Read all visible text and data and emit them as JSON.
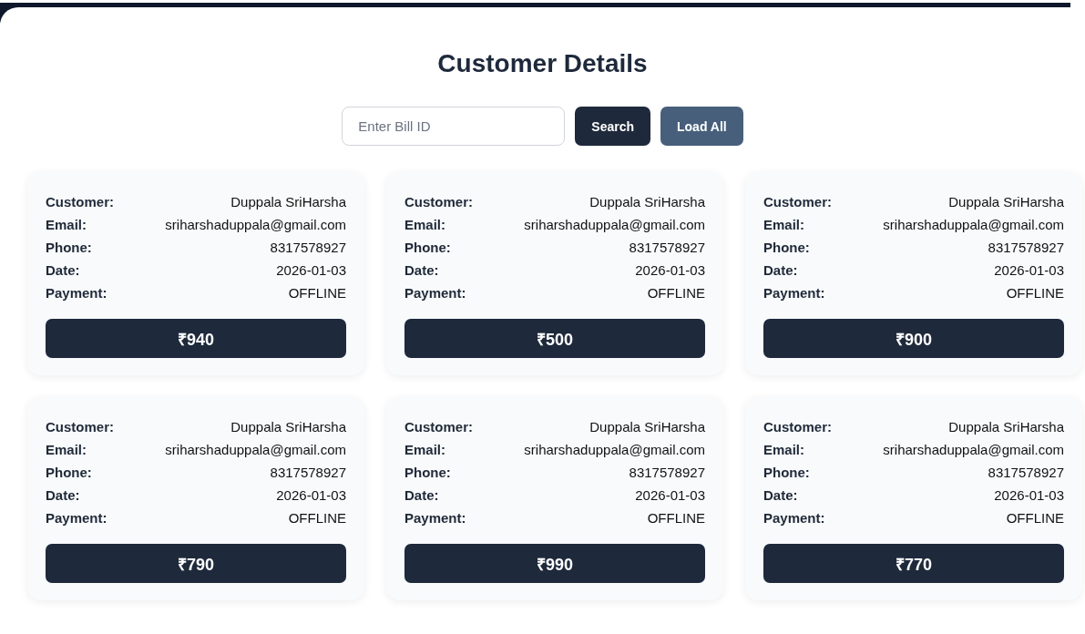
{
  "title": "Customer Details",
  "search": {
    "placeholder": "Enter Bill ID",
    "buttons": [
      {
        "label": "Search",
        "kind": "primary"
      },
      {
        "label": "Load All",
        "kind": "secondary"
      }
    ]
  },
  "bills": [
    {
      "fields": [
        {
          "label": "Customer:",
          "value": "Duppala SriHarsha"
        },
        {
          "label": "Email:",
          "value": "sriharshaduppala@gmail.com"
        },
        {
          "label": "Phone:",
          "value": "8317578927"
        },
        {
          "label": "Date:",
          "value": "2026-01-03"
        },
        {
          "label": "Payment:",
          "value": "OFFLINE"
        }
      ],
      "amount": "₹940"
    },
    {
      "fields": [
        {
          "label": "Customer:",
          "value": "Duppala SriHarsha"
        },
        {
          "label": "Email:",
          "value": "sriharshaduppala@gmail.com"
        },
        {
          "label": "Phone:",
          "value": "8317578927"
        },
        {
          "label": "Date:",
          "value": "2026-01-03"
        },
        {
          "label": "Payment:",
          "value": "OFFLINE"
        }
      ],
      "amount": "₹500"
    },
    {
      "fields": [
        {
          "label": "Customer:",
          "value": "Duppala SriHarsha"
        },
        {
          "label": "Email:",
          "value": "sriharshaduppala@gmail.com"
        },
        {
          "label": "Phone:",
          "value": "8317578927"
        },
        {
          "label": "Date:",
          "value": "2026-01-03"
        },
        {
          "label": "Payment:",
          "value": "OFFLINE"
        }
      ],
      "amount": "₹900"
    },
    {
      "fields": [
        {
          "label": "Customer:",
          "value": "Duppala SriHarsha"
        },
        {
          "label": "Email:",
          "value": "sriharshaduppala@gmail.com"
        },
        {
          "label": "Phone:",
          "value": "8317578927"
        },
        {
          "label": "Date:",
          "value": "2026-01-03"
        },
        {
          "label": "Payment:",
          "value": "OFFLINE"
        }
      ],
      "amount": "₹790"
    },
    {
      "fields": [
        {
          "label": "Customer:",
          "value": "Duppala SriHarsha"
        },
        {
          "label": "Email:",
          "value": "sriharshaduppala@gmail.com"
        },
        {
          "label": "Phone:",
          "value": "8317578927"
        },
        {
          "label": "Date:",
          "value": "2026-01-03"
        },
        {
          "label": "Payment:",
          "value": "OFFLINE"
        }
      ],
      "amount": "₹990"
    },
    {
      "fields": [
        {
          "label": "Customer:",
          "value": "Duppala SriHarsha"
        },
        {
          "label": "Email:",
          "value": "sriharshaduppala@gmail.com"
        },
        {
          "label": "Phone:",
          "value": "8317578927"
        },
        {
          "label": "Date:",
          "value": "2026-01-03"
        },
        {
          "label": "Payment:",
          "value": "OFFLINE"
        }
      ],
      "amount": "₹770"
    }
  ]
}
